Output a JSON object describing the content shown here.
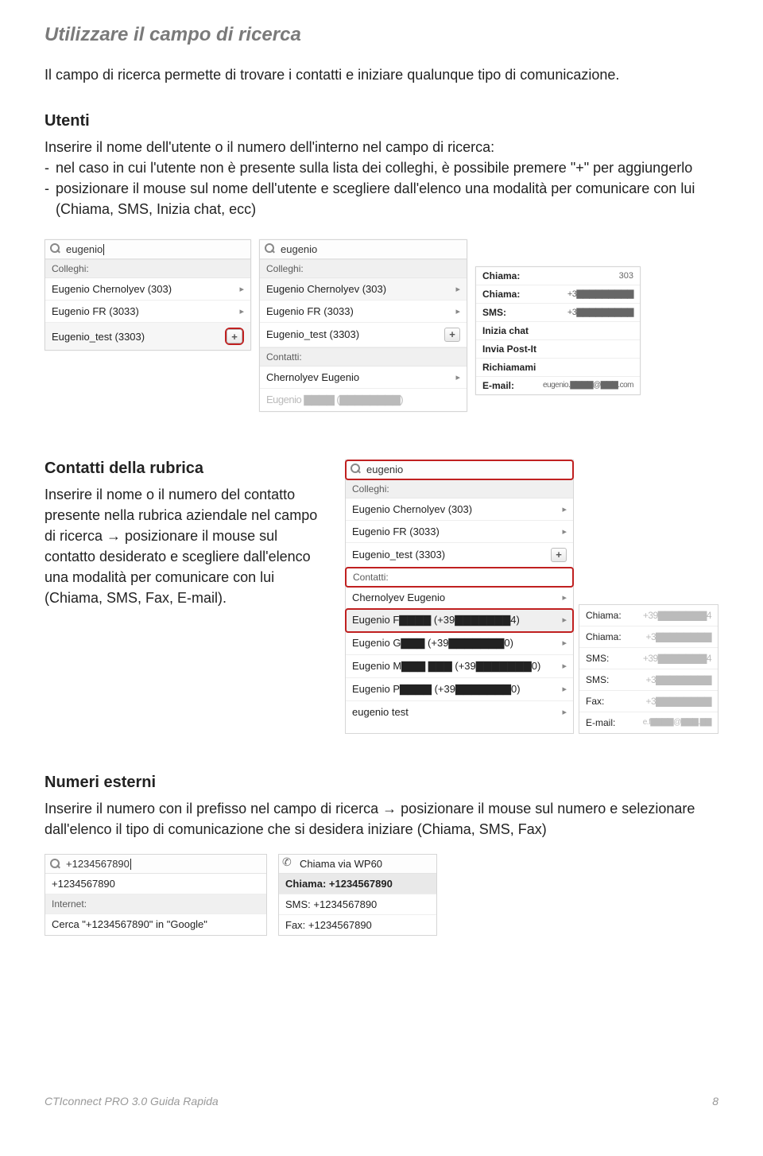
{
  "title": "Utilizzare il campo di ricerca",
  "intro": "Il campo di ricerca permette di trovare i contatti e iniziare qualunque tipo di comunicazione.",
  "utenti": {
    "heading": "Utenti",
    "desc": "Inserire il nome dell'utente o il numero dell'interno nel campo di ricerca:",
    "li1": "nel caso in cui l'utente non è presente sulla lista dei colleghi, è possibile premere \"+\" per aggiungerlo",
    "li2": "posizionare il mouse sul nome dell'utente e scegliere dall'elenco una modalità per comunicare con lui (Chiama, SMS, Inizia chat, ecc)"
  },
  "shot1": {
    "query": "eugenio",
    "hdr_colleghi": "Colleghi:",
    "r1": "Eugenio Chernolyev (303)",
    "r2": "Eugenio FR (3033)",
    "r3": "Eugenio_test (3303)"
  },
  "shot2": {
    "query": "eugenio",
    "hdr_colleghi": "Colleghi:",
    "r1": "Eugenio Chernolyev (303)",
    "r2": "Eugenio FR (3033)",
    "r3": "Eugenio_test (3303)",
    "hdr_contatti": "Contatti:",
    "r4": "Chernolyev Eugenio",
    "r5": "Eugenio ▇▇▇▇ (▇▇▇▇▇▇▇▇)"
  },
  "shot3": {
    "m1_k": "Chiama:",
    "m1_v": "303",
    "m2_k": "Chiama:",
    "m2_v": "+3▇▇▇▇▇▇▇▇▇",
    "m3_k": "SMS:",
    "m3_v": "+3▇▇▇▇▇▇▇▇▇",
    "m4": "Inizia chat",
    "m5": "Invia Post-It",
    "m6": "Richiamami",
    "m7_k": "E-mail:",
    "m7_v": "eugenio.▇▇▇▇@▇▇▇.com"
  },
  "contatti": {
    "heading": "Contatti della rubrica",
    "body": "Inserire il nome o il numero del contatto presente nella rubrica aziendale nel campo di ricerca → posizionare il mouse sul contatto desiderato e scegliere dall'elenco una modalità per comunicare con lui  (Chiama, SMS, Fax, E-mail)."
  },
  "shot4": {
    "query": "eugenio",
    "hdr_colleghi": "Colleghi:",
    "c1": "Eugenio Chernolyev (303)",
    "c2": "Eugenio FR (3033)",
    "c3": "Eugenio_test (3303)",
    "hdr_contatti": "Contatti:",
    "c4": "Chernolyev Eugenio",
    "c5": "Eugenio F▇▇▇▇ (+39▇▇▇▇▇▇▇4)",
    "c6": "Eugenio G▇▇▇ (+39▇▇▇▇▇▇▇0)",
    "c7": "Eugenio M▇▇▇ ▇▇▇ (+39▇▇▇▇▇▇▇0)",
    "c8": "Eugenio P▇▇▇▇ (+39▇▇▇▇▇▇▇0)",
    "c9": "eugenio test"
  },
  "shot5": {
    "m1_k": "Chiama:",
    "m1_v": "+39▇▇▇▇▇▇▇4",
    "m2_k": "Chiama:",
    "m2_v": "+3▇▇▇▇▇▇▇▇",
    "m3_k": "SMS:",
    "m3_v": "+39▇▇▇▇▇▇▇4",
    "m4_k": "SMS:",
    "m4_v": "+3▇▇▇▇▇▇▇▇",
    "m5_k": "Fax:",
    "m5_v": "+3▇▇▇▇▇▇▇▇",
    "m6_k": "E-mail:",
    "m6_v": "e.f▇▇▇▇@▇▇▇.▇▇"
  },
  "numeri": {
    "heading": "Numeri esterni",
    "body": "Inserire il numero con il prefisso nel campo di ricerca → posizionare il mouse sul numero e selezionare dall'elenco il tipo di comunicazione che si desidera iniziare (Chiama, SMS, Fax)"
  },
  "shot6": {
    "query": "+1234567890",
    "r1": "+1234567890",
    "hdr_internet": "Internet:",
    "r2": "Cerca \"+1234567890\" in \"Google\""
  },
  "shot7": {
    "top": "Chiama via WP60",
    "r1": "Chiama: +1234567890",
    "r2": "SMS: +1234567890",
    "r3": "Fax: +1234567890"
  },
  "footer": {
    "left": "CTIconnect PRO 3.0 Guida Rapida",
    "page": "8"
  }
}
